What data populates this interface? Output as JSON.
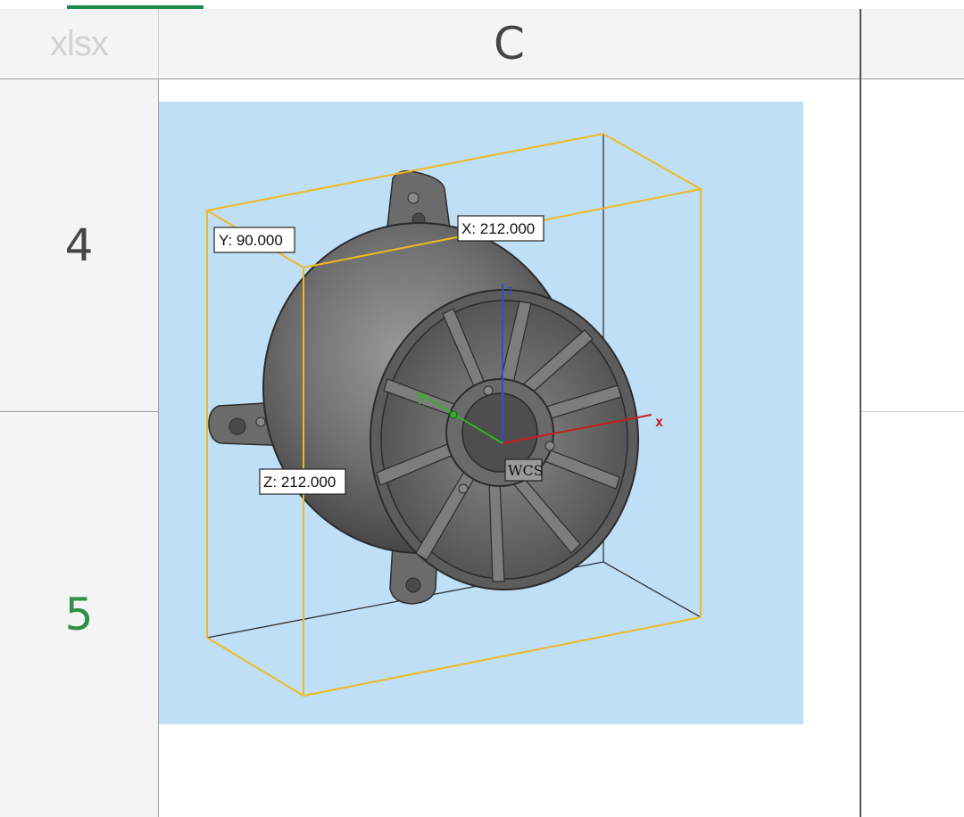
{
  "sheet": {
    "corner_label": "xlsx",
    "column_headers": [
      "C"
    ],
    "row_headers": [
      "4",
      "5"
    ]
  },
  "model_view": {
    "dimension_labels": {
      "x": "X: 212.000",
      "y": "Y: 90.000",
      "z": "Z: 212.000"
    },
    "axis_letters": {
      "x": "x",
      "y": "y",
      "z": "z"
    },
    "csys_label": "WCS",
    "colors": {
      "background": "#bfdff7",
      "bounding_box": "#f0b81f",
      "x_axis": "#c81e1e",
      "y_axis": "#2fb51f",
      "z_axis": "#2a4fd8",
      "part": "#6e6e6e"
    }
  }
}
